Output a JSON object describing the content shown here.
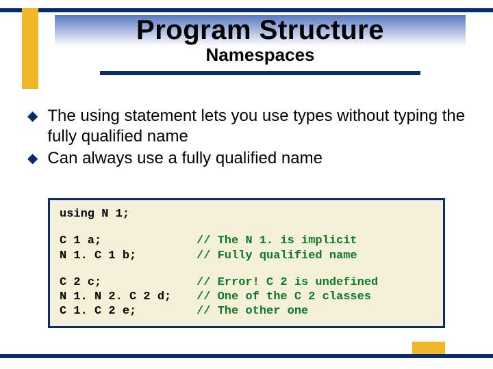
{
  "header": {
    "title": "Program Structure",
    "subtitle": "Namespaces"
  },
  "bullets": [
    "The using statement lets you use types without typing the fully qualified name",
    "Can always use a fully qualified name"
  ],
  "code": {
    "line_using": "using N 1;",
    "block1": [
      {
        "code": "C 1 a;",
        "comment": "// The N 1. is implicit"
      },
      {
        "code": "N 1. C 1 b;",
        "comment": "// Fully qualified name"
      }
    ],
    "block2": [
      {
        "code": "C 2 c;",
        "comment": "// Error! C 2 is undefined"
      },
      {
        "code": "N 1. N 2. C 2 d;",
        "comment": "// One of the C 2 classes"
      },
      {
        "code": "C 1. C 2 e;",
        "comment": "// The other one"
      }
    ]
  }
}
